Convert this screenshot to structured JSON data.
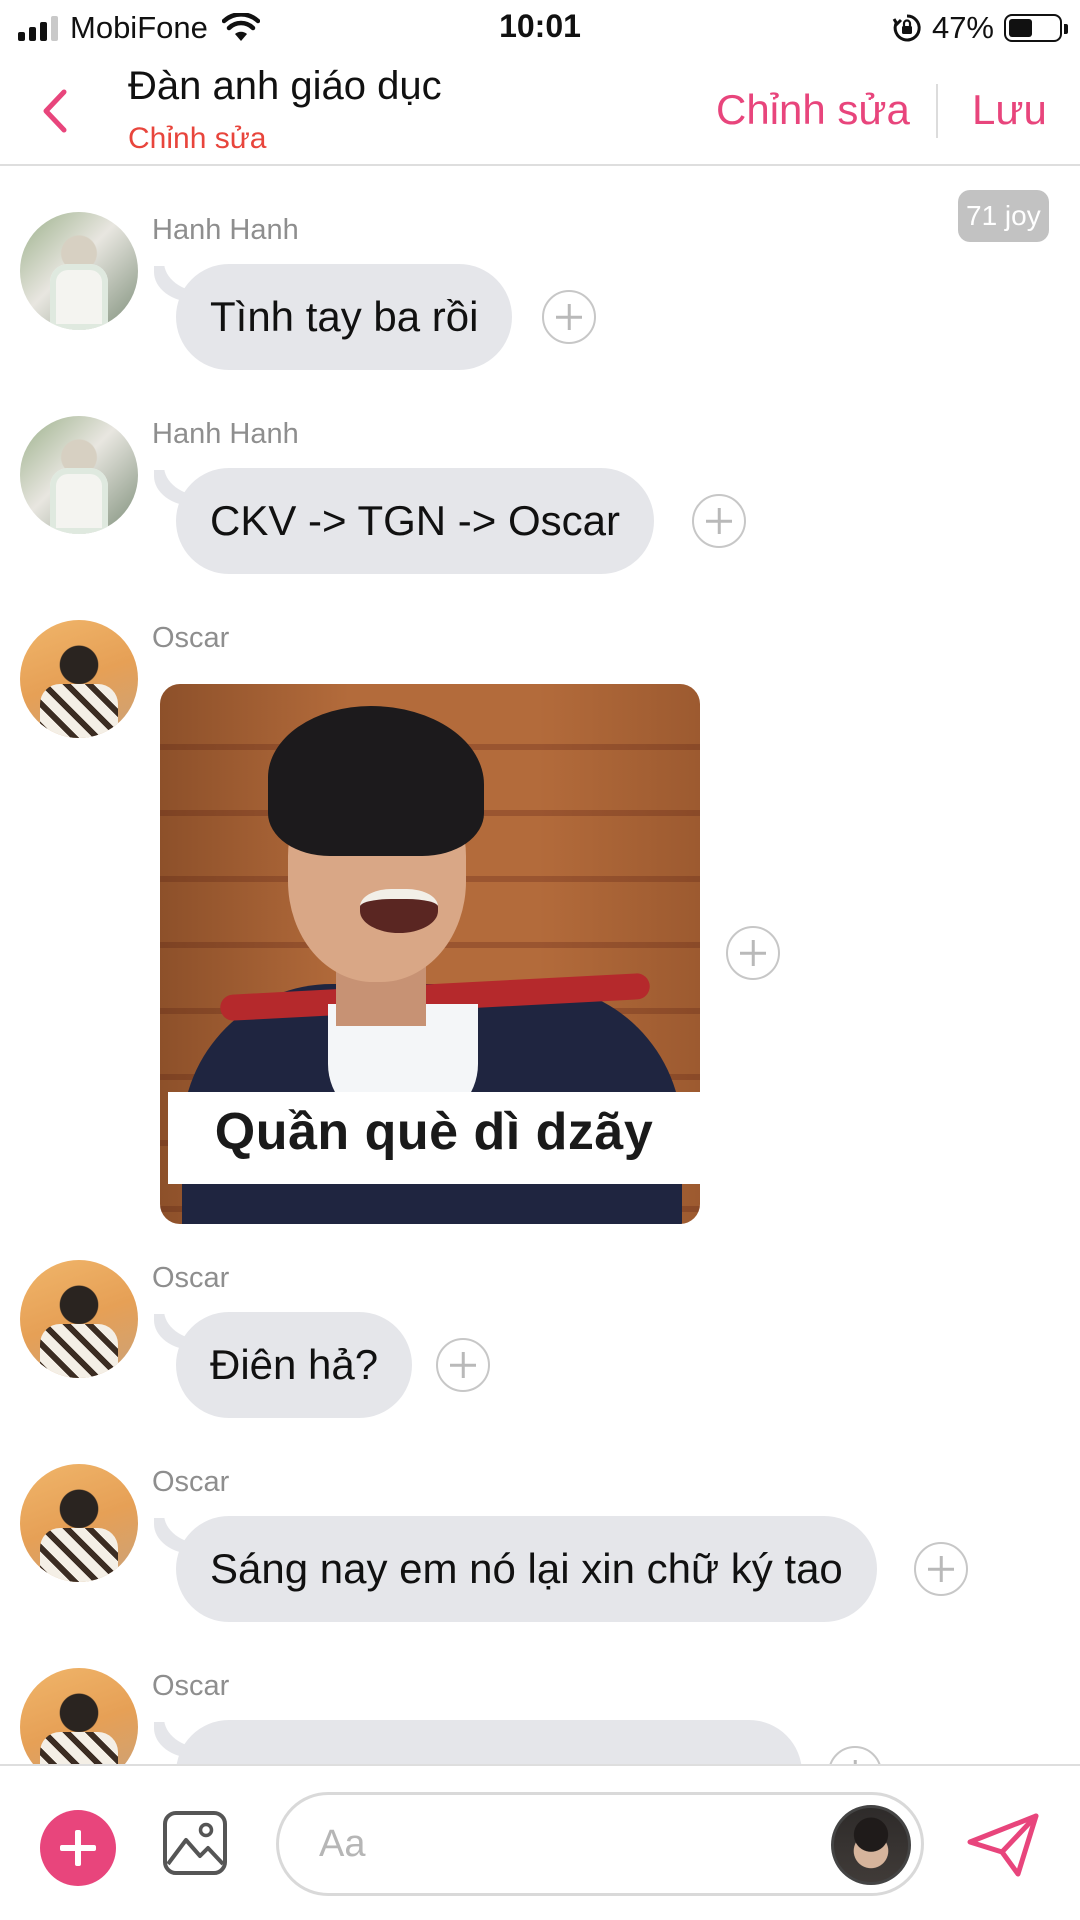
{
  "status_bar": {
    "carrier": "MobiFone",
    "time": "10:01",
    "battery": "47%",
    "battery_level": 0.47
  },
  "header": {
    "title": "Đàn anh giáo dục",
    "subtitle": "Chỉnh sửa",
    "edit_label": "Chỉnh sửa",
    "save_label": "Lưu",
    "accent_color": "#e8457c"
  },
  "chat": {
    "badge": "71 joy",
    "messages": [
      {
        "sender": "Hanh Hanh",
        "avatar": "hanh",
        "type": "text",
        "text": "Tình tay ba rồi"
      },
      {
        "sender": "Hanh Hanh",
        "avatar": "hanh",
        "type": "text",
        "text": "CKV -> TGN -> Oscar"
      },
      {
        "sender": "Oscar",
        "avatar": "oscar",
        "type": "image",
        "caption": "Quần què dì dzãy"
      },
      {
        "sender": "Oscar",
        "avatar": "oscar",
        "type": "text",
        "text": "Điên hả?"
      },
      {
        "sender": "Oscar",
        "avatar": "oscar",
        "type": "text",
        "text": "Sáng nay em nó lại xin chữ ký tao"
      },
      {
        "sender": "Oscar",
        "avatar": "oscar",
        "type": "text",
        "text": ""
      }
    ]
  },
  "composer": {
    "placeholder": "Aa",
    "icons": [
      "add-icon",
      "image-icon",
      "send-icon"
    ]
  }
}
